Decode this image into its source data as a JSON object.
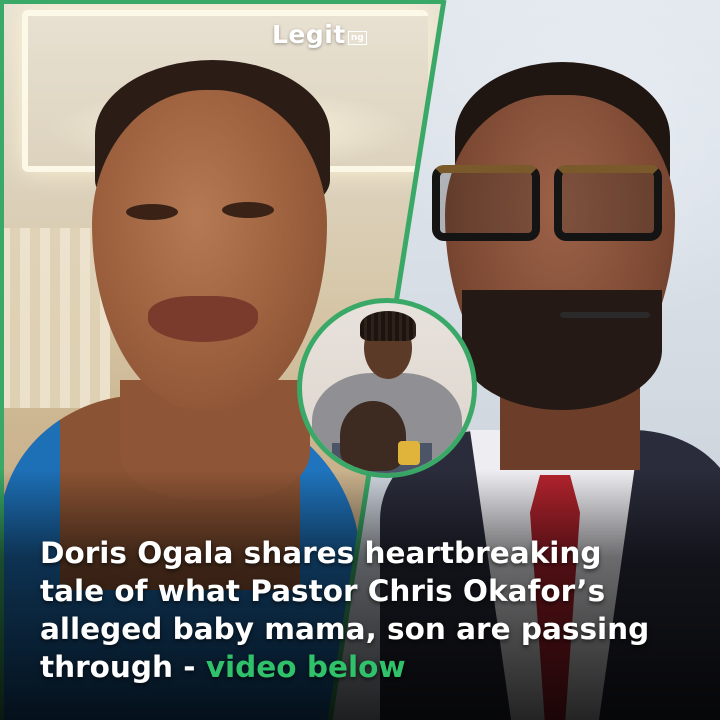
{
  "logo": {
    "word": "Legit",
    "badge": "ng"
  },
  "headline": {
    "line1": "Doris Ogala shares heartbreaking",
    "line2": "tale of what Pastor Chris Okafor’s",
    "line3": "alleged baby mama, son are passing",
    "line4_main": "through - ",
    "line4_highlight": "video below"
  },
  "colors": {
    "accent_green": "#2fc26b",
    "divider_green": "#3aa867",
    "text": "#ffffff"
  }
}
